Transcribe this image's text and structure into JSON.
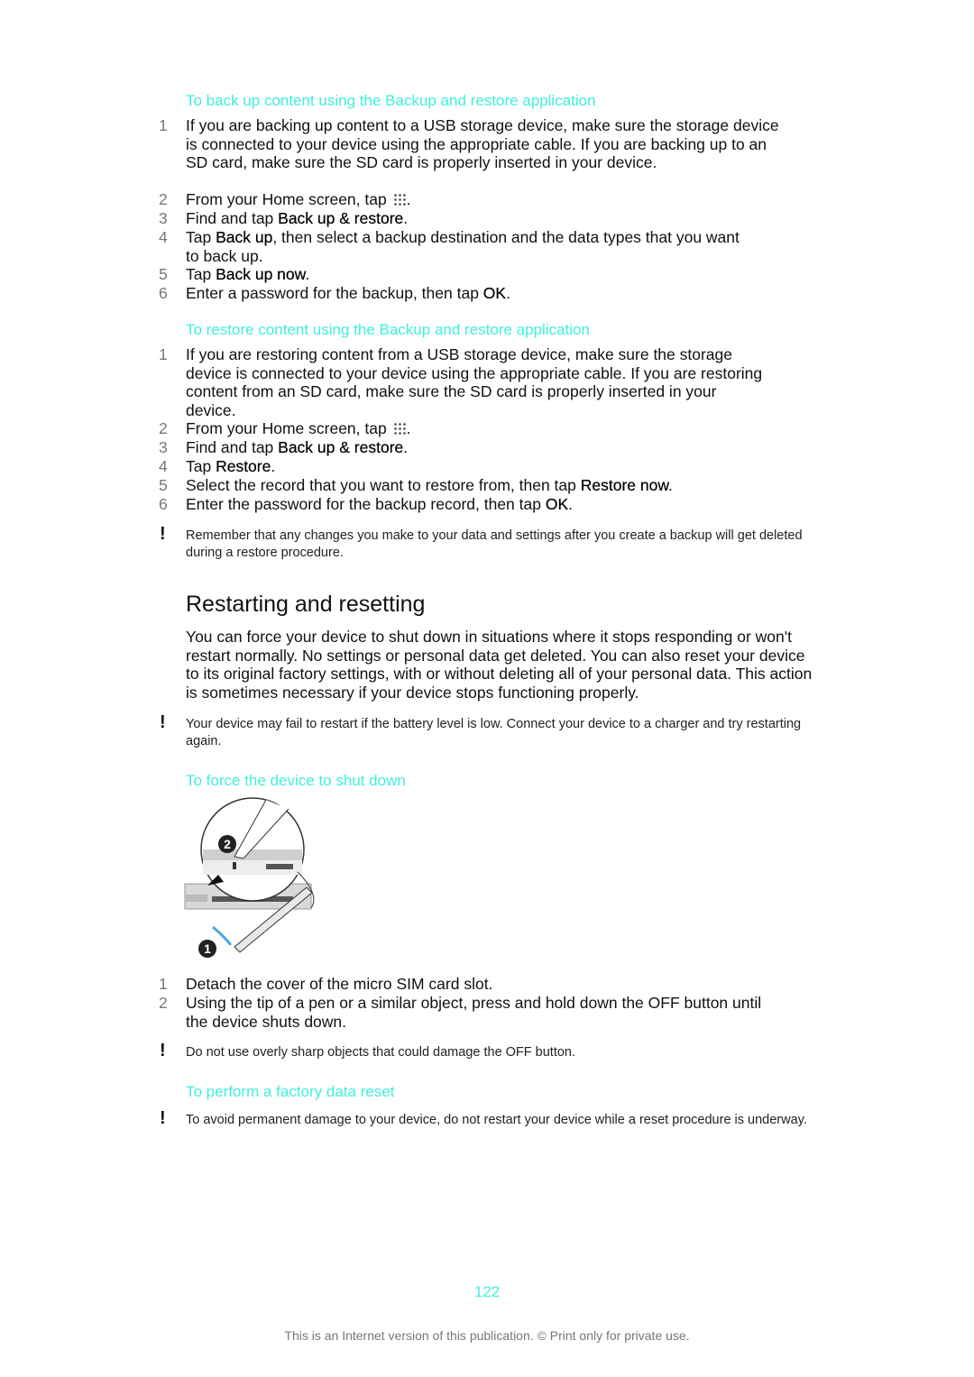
{
  "backup": {
    "heading": "To back up content using the Backup and restore application",
    "steps": [
      {
        "num": "1",
        "parts": [
          "If you are backing up content to a USB storage device, make sure the storage device is connected to your device using the appropriate cable. If you are backing up to an SD card, make sure the SD card is properly inserted in your device."
        ]
      },
      {
        "num": "2",
        "pre": "From your Home screen, tap ",
        "post": "."
      },
      {
        "num": "3",
        "pre": "Find and tap ",
        "bold": "Back up & restore",
        "post": "."
      },
      {
        "num": "4",
        "pre": "Tap ",
        "bold": "Back up",
        "post": ", then select a backup destination and the data types that you want to back up."
      },
      {
        "num": "5",
        "pre": "Tap ",
        "bold": "Back up now",
        "post": "."
      },
      {
        "num": "6",
        "pre": "Enter a password for the backup, then tap ",
        "bold": "OK",
        "post": "."
      }
    ]
  },
  "restore": {
    "heading": "To restore content using the Backup and restore application",
    "steps": [
      {
        "num": "1",
        "text": "If you are restoring content from a USB storage device, make sure the storage device is connected to your device using the appropriate cable. If you are restoring content from an SD card, make sure the SD card is properly inserted in your device."
      },
      {
        "num": "2",
        "pre": "From your Home screen, tap ",
        "post": "."
      },
      {
        "num": "3",
        "pre": "Find and tap ",
        "bold": "Back up & restore",
        "post": "."
      },
      {
        "num": "4",
        "pre": "Tap ",
        "bold": "Restore",
        "post": "."
      },
      {
        "num": "5",
        "pre": "Select the record that you want to restore from, then tap ",
        "bold": "Restore now",
        "post": "."
      },
      {
        "num": "6",
        "pre": "Enter the password for the backup record, then tap ",
        "bold": "OK",
        "post": "."
      }
    ],
    "note": "Remember that any changes you make to your data and settings after you create a backup will get deleted during a restore procedure."
  },
  "restarting": {
    "title": "Restarting and resetting",
    "paragraph": "You can force your device to shut down in situations where it stops responding or won't restart normally. No settings or personal data get deleted. You can also reset your device to its original factory settings, with or without deleting all of your personal data. This action is sometimes necessary if your device stops functioning properly.",
    "note": "Your device may fail to restart if the battery level is low. Connect your device to a charger and try restarting again."
  },
  "shutdown": {
    "heading": "To force the device to shut down",
    "illustration_labels": [
      "1",
      "2"
    ],
    "steps": [
      {
        "num": "1",
        "text": "Detach the cover of the micro SIM card slot."
      },
      {
        "num": "2",
        "text": "Using the tip of a pen or a similar object, press and hold down the OFF button until the device shuts down."
      }
    ],
    "note": "Do not use overly sharp objects that could damage the OFF button."
  },
  "factory": {
    "heading": "To perform a factory data reset",
    "note": "To avoid permanent damage to your device, do not restart your device while a reset procedure is underway."
  },
  "page_number": "122",
  "footer": "This is an Internet version of this publication. © Print only for private use.",
  "colors": {
    "accent": "#3ff0dc",
    "text": "#111111",
    "muted": "#777777"
  }
}
